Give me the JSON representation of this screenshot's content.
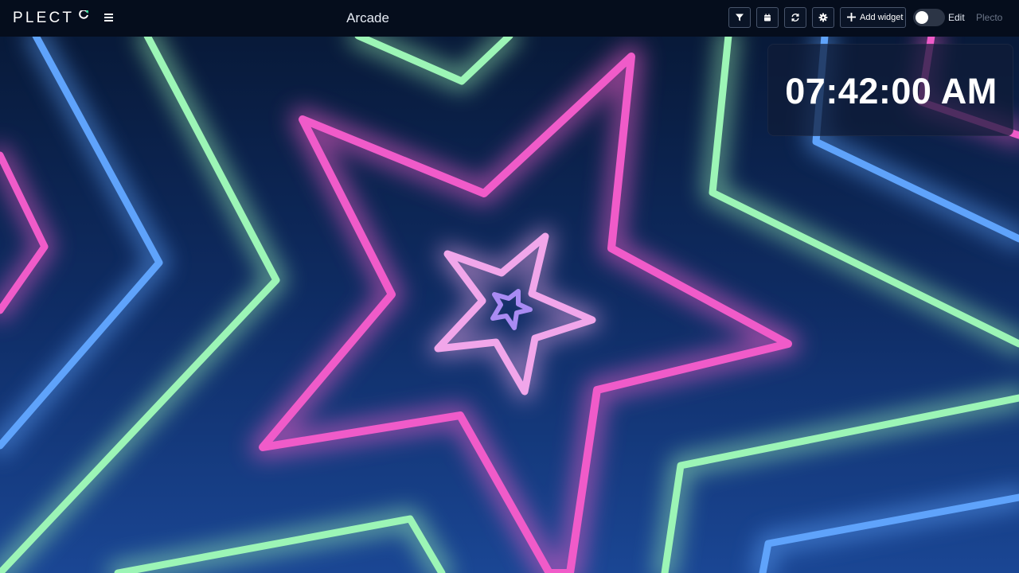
{
  "topbar": {
    "logo_text": "PLECT",
    "page_title": "Arcade",
    "buttons": {
      "filter_icon": "filter-icon",
      "calendar_icon": "calendar-icon",
      "refresh_icon": "refresh-icon",
      "settings_icon": "gear-icon",
      "add_widget_label": "Add widget"
    },
    "edit_label": "Edit",
    "edit_toggle_on": false,
    "user_label": "Plecto"
  },
  "clock_widget": {
    "time": "07:42:00 AM"
  },
  "colors": {
    "accent_green": "#2ee39a",
    "neon_pink": "#f05bc9",
    "neon_green": "#9cf5b6",
    "neon_blue": "#5fa3fb",
    "neon_purple": "#a98bf3",
    "light_pink": "#f1a6ea",
    "topbar_bg": "#050d1c"
  }
}
